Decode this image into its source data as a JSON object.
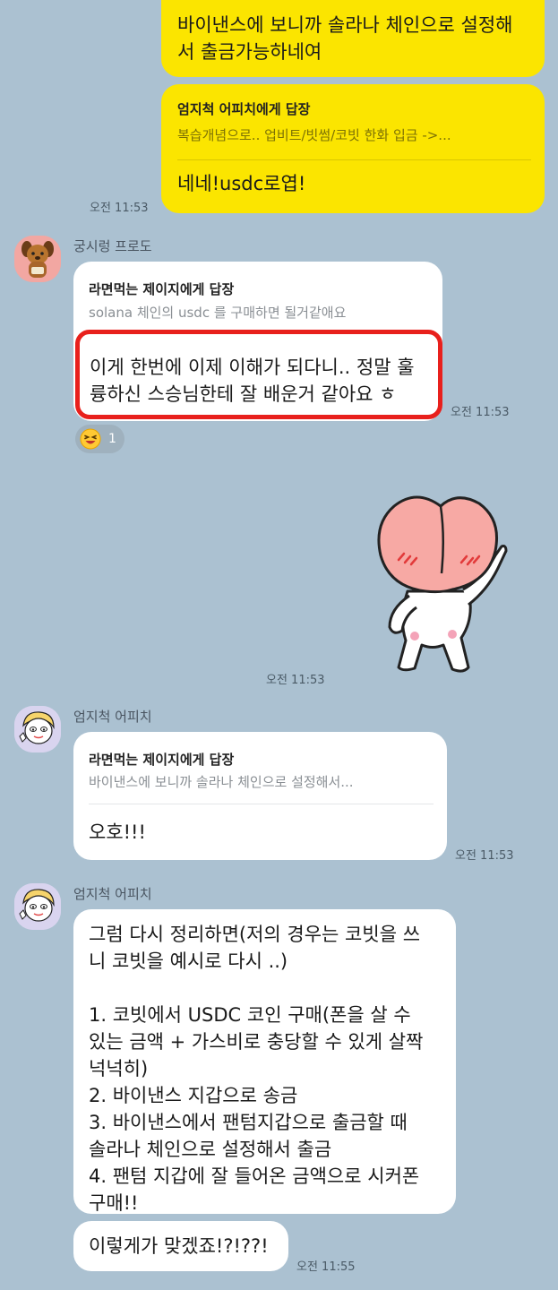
{
  "messages": {
    "m1": {
      "text": "바이낸스에 보니까 솔라나 체인으로 설정해\n서 출금가능하네여"
    },
    "m2": {
      "reply_title": "엄지척 어피치에게 답장",
      "reply_preview": "복습개념으로.. 업비트/빗썸/코빗 한화 입금 ->...",
      "text": "네네!usdc로엽!",
      "time": "오전 11:53"
    },
    "m3": {
      "sender": "궁시렁 프로도",
      "reply_title": "라면먹는 제이지에게 답장",
      "reply_preview": "solana 체인의 usdc 를 구매하면 될거같애요",
      "text": "이게 한번에 이제 이해가 되다니.. 정말 훌\n륭하신 스승님한테 잘 배운거 같아요 ㅎ",
      "time": "오전 11:53",
      "reaction_count": "1"
    },
    "m4": {
      "time": "오전 11:53"
    },
    "m5": {
      "sender": "엄지척 어피치",
      "reply_title": "라면먹는 제이지에게 답장",
      "reply_preview": "바이낸스에 보니까 솔라나 체인으로 설정해서...",
      "text": "오호!!!",
      "time": "오전 11:53"
    },
    "m6": {
      "sender": "엄지척 어피치",
      "text": "그럼 다시 정리하면(저의 경우는 코빗을 쓰\n니 코빗을 예시로 다시 ..)\n\n1. 코빗에서 USDC 코인 구매(폰을 살 수\n있는 금액 + 가스비로 충당할 수 있게 살짝\n넉넉히)\n2. 바이낸스 지갑으로 송금\n3. 바이낸스에서 팬텀지갑으로 출금할 때\n솔라나 체인으로 설정해서 출금\n4. 팬텀 지갑에 잘 들어온 금액으로 시커폰\n구매!!"
    },
    "m7": {
      "text": "이렇게가 맞겠죠!?!??!",
      "time": "오전 11:55"
    }
  },
  "colors": {
    "background": "#abc1d1",
    "my_bubble": "#fbe500",
    "their_bubble": "#ffffff",
    "highlight_border": "#e8201c"
  },
  "icons": {
    "frodo_avatar": "dog-avatar-icon",
    "apeach_avatar": "apeach-avatar-icon",
    "reaction": "grinning-emoji-icon",
    "sticker": "apeach-sticker"
  }
}
